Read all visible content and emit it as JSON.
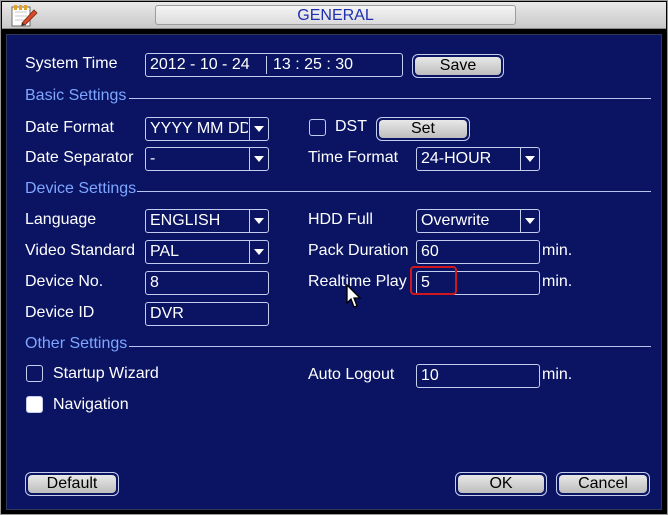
{
  "window": {
    "title": "GENERAL"
  },
  "system_time": {
    "label": "System Time",
    "date": "2012  - 10 - 24",
    "time": "13 : 25 : 30",
    "save_label": "Save"
  },
  "basic": {
    "heading": "Basic Settings",
    "date_format_label": "Date Format",
    "date_format_value": "YYYY MM DD",
    "dst_label": "DST",
    "dst_checked": false,
    "set_label": "Set",
    "date_separator_label": "Date Separator",
    "date_separator_value": "-",
    "time_format_label": "Time Format",
    "time_format_value": "24-HOUR"
  },
  "device": {
    "heading": "Device Settings",
    "language_label": "Language",
    "language_value": "ENGLISH",
    "hdd_full_label": "HDD Full",
    "hdd_full_value": "Overwrite",
    "video_standard_label": "Video Standard",
    "video_standard_value": "PAL",
    "pack_duration_label": "Pack Duration",
    "pack_duration_value": "60",
    "pack_duration_unit": "min.",
    "device_no_label": "Device No.",
    "device_no_value": "8",
    "realtime_play_label": "Realtime Play",
    "realtime_play_value": "5",
    "realtime_play_unit": "min.",
    "device_id_label": "Device ID",
    "device_id_value": "DVR"
  },
  "other": {
    "heading": "Other Settings",
    "startup_wizard_label": "Startup Wizard",
    "startup_wizard_checked": false,
    "navigation_label": "Navigation",
    "navigation_checked": true,
    "auto_logout_label": "Auto Logout",
    "auto_logout_value": "10",
    "auto_logout_unit": "min."
  },
  "footer": {
    "default_label": "Default",
    "ok_label": "OK",
    "cancel_label": "Cancel"
  },
  "colors": {
    "panel_bg": "#0a1463",
    "section_heading": "#7ea6ff",
    "title_text": "#1e2fb0",
    "focus_outline": "#d0181c"
  }
}
